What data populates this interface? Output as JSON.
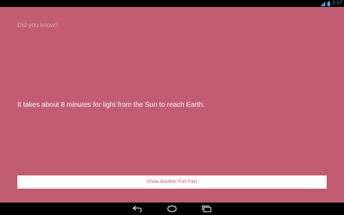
{
  "status_bar": {
    "time": "1:17",
    "icons": [
      "wifi-icon",
      "battery-icon"
    ]
  },
  "main": {
    "prompt": "Did you know?",
    "fact": "It takes about 8 minutes for light from the Sun to reach Earth.",
    "button_label": "Show Another Fun Fact"
  },
  "nav_bar": {
    "icons": [
      "back-icon",
      "home-icon",
      "recent-apps-icon"
    ]
  },
  "colors": {
    "background": "#c25c72",
    "prompt_text": "#e6a7b5",
    "fact_text": "#ffffff",
    "button_background": "#ffffff",
    "button_text": "#c25c72",
    "status_icons": "#3fa9dc"
  }
}
